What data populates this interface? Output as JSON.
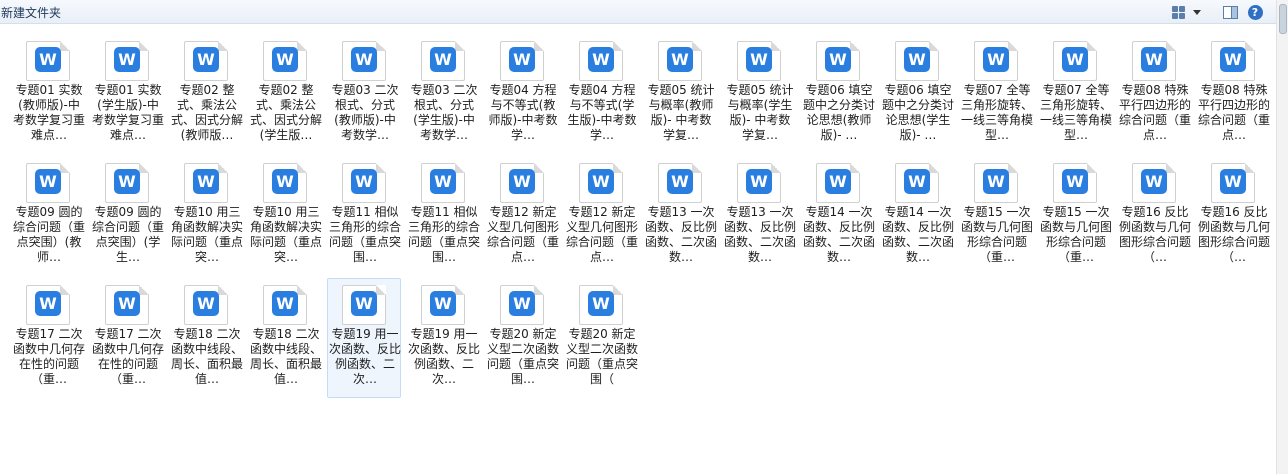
{
  "window": {
    "title": "新建文件夹"
  },
  "toolbar": {
    "view_icon": "view-change-icon",
    "dropdown_icon": "chevron-down-icon",
    "pane_icon": "preview-pane-icon",
    "help_icon": "help-icon",
    "help_label": "?"
  },
  "file_icon_letter": "W",
  "colors": {
    "accent": "#2a7ee0",
    "toolbar_bg": "#e9eff7",
    "selection": "#eef5fd"
  },
  "files": [
    {
      "label": "专题01 实数(教师版)-中考数学复习重难点…"
    },
    {
      "label": "专题01 实数(学生版)-中考数学复习重难点…"
    },
    {
      "label": "专题02 整式、乘法公式、因式分解(教师版…"
    },
    {
      "label": "专题02 整式、乘法公式、因式分解(学生版…"
    },
    {
      "label": "专题03 二次根式、分式(教师版)-中考数学…"
    },
    {
      "label": "专题03 二次根式、分式(学生版)-中考数学…"
    },
    {
      "label": "专题04 方程与不等式(教师版)-中考数学…"
    },
    {
      "label": "专题04 方程与不等式(学生版)-中考数学…"
    },
    {
      "label": "专题05 统计与概率(教师版)- 中考数学复…"
    },
    {
      "label": "专题05 统计与概率(学生版)- 中考数学复…"
    },
    {
      "label": "专题06 填空题中之分类讨论思想(教师版)- …"
    },
    {
      "label": "专题06 填空题中之分类讨论思想(学生版)- …"
    },
    {
      "label": "专题07 全等三角形旋转、一线三等角模型…"
    },
    {
      "label": "专题07 全等三角形旋转、一线三等角模型…"
    },
    {
      "label": "专题08 特殊平行四边形的综合问题（重点…"
    },
    {
      "label": "专题08 特殊平行四边形的综合问题（重点…"
    },
    {
      "label": "专题09 圆的综合问题（重点突围）(教师…"
    },
    {
      "label": "专题09 圆的综合问题（重点突围）(学生…"
    },
    {
      "label": "专题10 用三角函数解决实际问题（重点突…"
    },
    {
      "label": "专题10 用三角函数解决实际问题（重点突…"
    },
    {
      "label": "专题11 相似三角形的综合问题（重点突围…"
    },
    {
      "label": "专题11 相似三角形的综合问题（重点突围…"
    },
    {
      "label": "专题12 新定义型几何图形综合问题（重点…"
    },
    {
      "label": "专题12 新定义型几何图形综合问题（重点…"
    },
    {
      "label": "专题13 一次函数、反比例函数、二次函数…"
    },
    {
      "label": "专题13 一次函数、反比例函数、二次函数…"
    },
    {
      "label": "专题14 一次函数、反比例函数、二次函数…"
    },
    {
      "label": "专题14 一次函数、反比例函数、二次函数…"
    },
    {
      "label": "专题15 一次函数与几何图形综合问题（重…"
    },
    {
      "label": "专题15 一次函数与几何图形综合问题（重…"
    },
    {
      "label": "专题16 反比例函数与几何图形综合问题（…"
    },
    {
      "label": "专题16 反比例函数与几何图形综合问题（…"
    },
    {
      "label": "专题17 二次函数中几何存在性的问题（重…"
    },
    {
      "label": "专题17 二次函数中几何存在性的问题（重…"
    },
    {
      "label": "专题18 二次函数中线段、周长、面积最值…"
    },
    {
      "label": "专题18 二次函数中线段、周长、面积最值…"
    },
    {
      "label": "专题19 用一次函数、反比例函数、二次…",
      "selected": true
    },
    {
      "label": "专题19 用一次函数、反比例函数、二次…"
    },
    {
      "label": "专题20 新定义型二次函数问题（重点突围…"
    },
    {
      "label": "专题20 新定义型二次函数问题（重点突围（"
    }
  ]
}
